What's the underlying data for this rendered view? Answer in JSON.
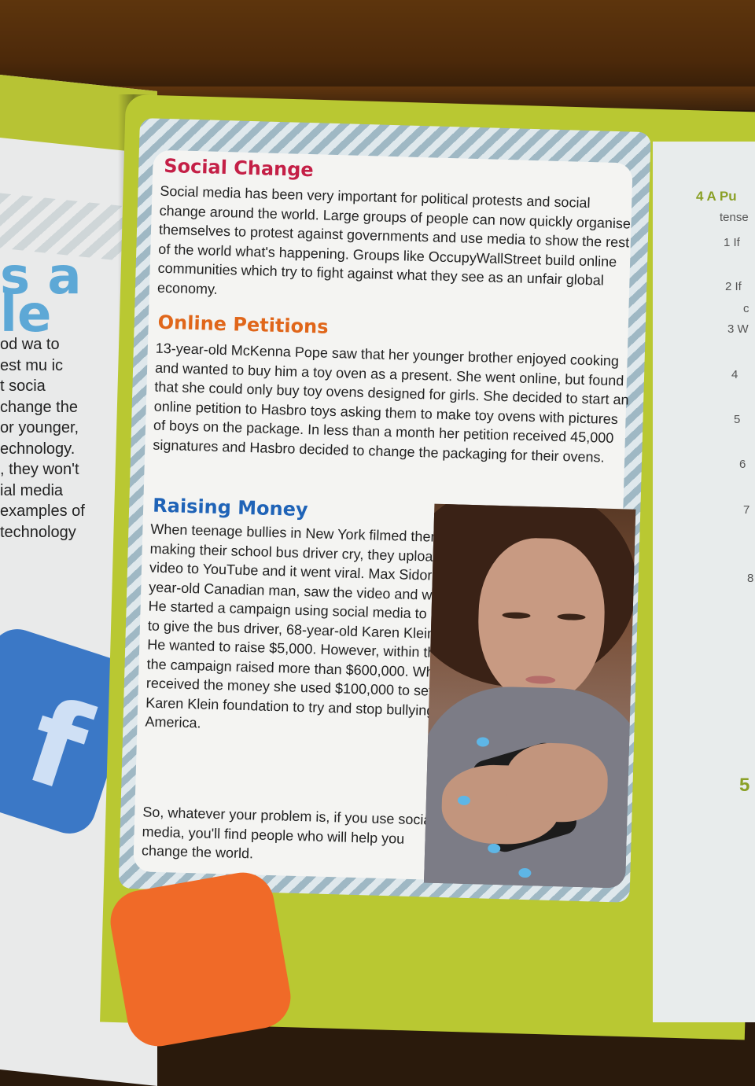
{
  "left_page": {
    "big_text": [
      "s a",
      "le"
    ],
    "lines": [
      "od wa  to",
      "est mu ic",
      "t socia",
      "change the",
      "or younger,",
      "echnology.",
      ", they won't",
      "ial media",
      "examples of",
      "technology"
    ]
  },
  "right_margin": {
    "exercise": "4 A Pu",
    "tense": "tense",
    "items": [
      "1 If",
      "2 If",
      "c",
      "3 W",
      "4",
      "5",
      "6",
      "7",
      "8",
      "5"
    ]
  },
  "article": {
    "social_change": {
      "heading": "Social Change",
      "body": "Social media has been very important for political protests and social change around the world. Large groups of people can now quickly organise themselves to protest against governments and use media to show the rest of the world what's happening. Groups like OccupyWallStreet build online communities which try to fight against what they see as an unfair global economy."
    },
    "online_petitions": {
      "heading": "Online Petitions",
      "body": "13-year-old McKenna Pope saw that her younger brother enjoyed cooking and wanted to buy him a toy oven as a present. She went online, but found that she could only buy toy ovens designed for girls. She decided to start an online petition to Hasbro toys asking them to make toy ovens with pictures of boys on the package. In less than a month her petition received 45,000 signatures and Hasbro decided to change the packaging for their ovens."
    },
    "raising_money": {
      "heading": "Raising Money",
      "body": "When teenage bullies in New York filmed themselves making their school bus driver cry, they uploaded the video to YouTube and it went viral. Max Sidorov, a 25-year-old Canadian man, saw the video and was shocked. He started a campaign using social media to raise money to give the bus driver, 68-year-old Karen Klein, a holiday. He wanted to raise $5,000. However, within three weeks the campaign raised more than $600,000. When Karen received the money she used $100,000 to set up the Karen Klein foundation to try and stop bullying across America.",
      "closing": "So, whatever your problem is, if you use social media, you'll find people who will help you change the world."
    }
  },
  "colors": {
    "page_green": "#b9c832",
    "heading_social": "#c41f46",
    "heading_online": "#e0661a",
    "heading_raising": "#1f63b7"
  }
}
